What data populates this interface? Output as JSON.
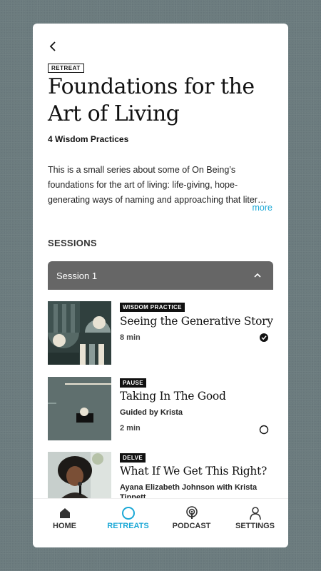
{
  "retreat": {
    "tag": "RETREAT",
    "title": "Foundations for the Art of Living",
    "subtitle": "4 Wisdom Practices",
    "description": "This is a small series about some of On Being’s foundations for the art of living: life-giving, hope-generating ways of naming and approaching that liter…",
    "more_label": "more"
  },
  "sessions": {
    "heading": "SESSIONS",
    "current_label": "Session 1",
    "items": [
      {
        "badge": "WISDOM PRACTICE",
        "title": "Seeing the Generative Story",
        "subtitle": "",
        "duration": "8 min",
        "completed": true
      },
      {
        "badge": "PAUSE",
        "title": "Taking In The Good",
        "subtitle": "Guided by Krista",
        "duration": "2 min",
        "completed": false
      },
      {
        "badge": "DELVE",
        "title": "What If We Get This Right?",
        "subtitle": "Ayana Elizabeth Johnson with Krista Tippett",
        "duration": "",
        "completed": false
      }
    ]
  },
  "nav": {
    "home": "HOME",
    "retreats": "RETREATS",
    "podcast": "PODCAST",
    "settings": "SETTINGS",
    "active": "retreats"
  },
  "colors": {
    "accent": "#1ba8d6",
    "background": "#6b7b7e",
    "session_bar": "#666666"
  }
}
